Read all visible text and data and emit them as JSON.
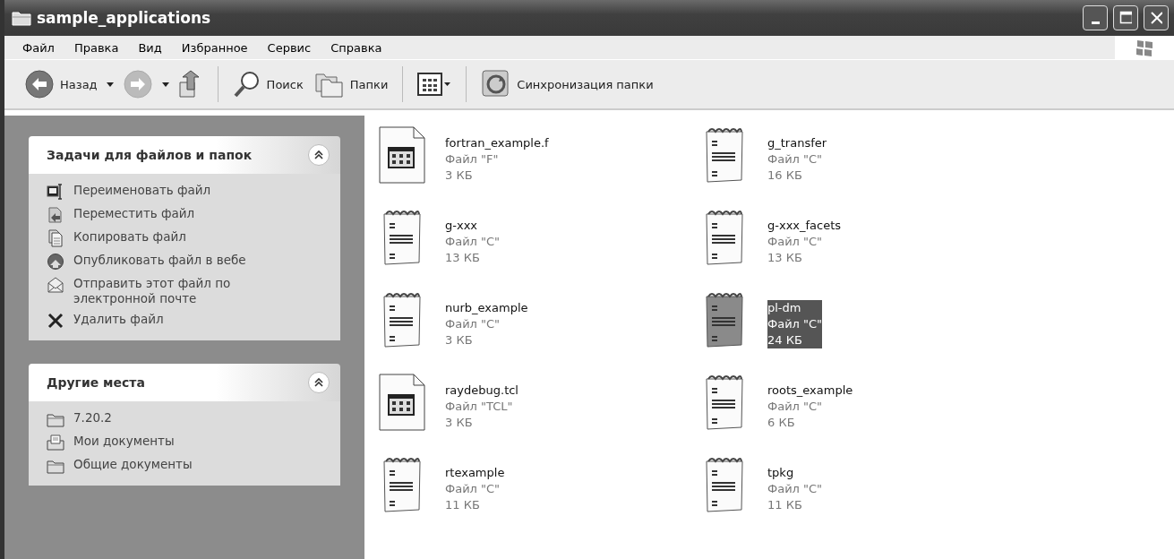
{
  "window": {
    "title": "sample_applications"
  },
  "menu": [
    "Файл",
    "Правка",
    "Вид",
    "Избранное",
    "Сервис",
    "Справка"
  ],
  "toolbar": {
    "back": "Назад",
    "search": "Поиск",
    "folders": "Папки",
    "sync": "Синхронизация папки"
  },
  "task_panels": [
    {
      "title": "Задачи для файлов и папок",
      "expanded": true,
      "items": [
        {
          "label": "Переименовать файл",
          "kind": "rename"
        },
        {
          "label": "Переместить файл",
          "kind": "move"
        },
        {
          "label": "Копировать файл",
          "kind": "copy"
        },
        {
          "label": "Опубликовать файл в вебе",
          "kind": "web"
        },
        {
          "label": "Отправить этот файл по электронной почте",
          "kind": "mail"
        },
        {
          "label": "Удалить файл",
          "kind": "delete"
        }
      ]
    },
    {
      "title": "Другие места",
      "expanded": true,
      "items": [
        {
          "label": "7.20.2",
          "kind": "folder"
        },
        {
          "label": "Мои документы",
          "kind": "docs"
        },
        {
          "label": "Общие документы",
          "kind": "folder"
        }
      ]
    }
  ],
  "files": [
    {
      "name": "fortran_example.f",
      "type": "Файл \"F\"",
      "size": "3 КБ",
      "kind": "app",
      "selected": false
    },
    {
      "name": "g_transfer",
      "type": "Файл \"C\"",
      "size": "16 КБ",
      "kind": "text",
      "selected": false
    },
    {
      "name": "g-xxx",
      "type": "Файл \"C\"",
      "size": "13 КБ",
      "kind": "text",
      "selected": false
    },
    {
      "name": "g-xxx_facets",
      "type": "Файл \"C\"",
      "size": "13 КБ",
      "kind": "text",
      "selected": false
    },
    {
      "name": "nurb_example",
      "type": "Файл \"C\"",
      "size": "3 КБ",
      "kind": "text",
      "selected": false
    },
    {
      "name": "pl-dm",
      "type": "Файл \"C\"",
      "size": "24 КБ",
      "kind": "text",
      "selected": true
    },
    {
      "name": "raydebug.tcl",
      "type": "Файл \"TCL\"",
      "size": "3 КБ",
      "kind": "app",
      "selected": false
    },
    {
      "name": "roots_example",
      "type": "Файл \"C\"",
      "size": "6 КБ",
      "kind": "text",
      "selected": false
    },
    {
      "name": "rtexample",
      "type": "Файл \"C\"",
      "size": "11 КБ",
      "kind": "text",
      "selected": false
    },
    {
      "name": "tpkg",
      "type": "Файл \"C\"",
      "size": "11 КБ",
      "kind": "text",
      "selected": false
    }
  ]
}
